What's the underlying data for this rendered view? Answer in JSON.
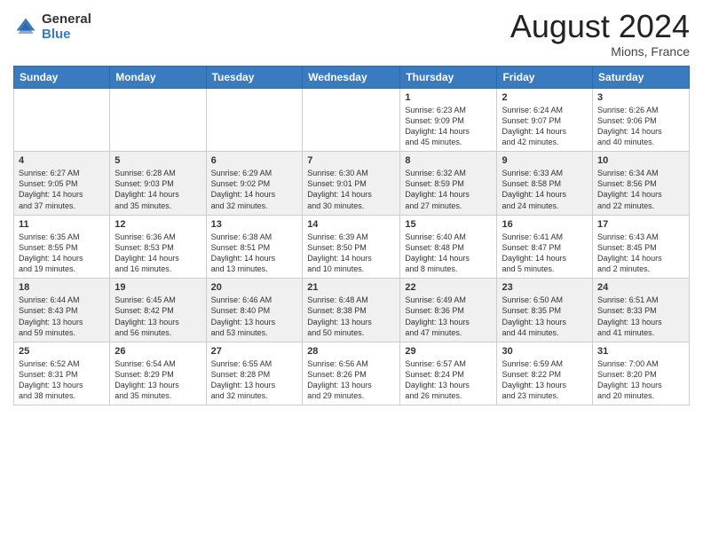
{
  "header": {
    "logo_general": "General",
    "logo_blue": "Blue",
    "month_year": "August 2024",
    "location": "Mions, France"
  },
  "calendar": {
    "days_of_week": [
      "Sunday",
      "Monday",
      "Tuesday",
      "Wednesday",
      "Thursday",
      "Friday",
      "Saturday"
    ],
    "weeks": [
      [
        {
          "day": "",
          "info": ""
        },
        {
          "day": "",
          "info": ""
        },
        {
          "day": "",
          "info": ""
        },
        {
          "day": "",
          "info": ""
        },
        {
          "day": "1",
          "info": "Sunrise: 6:23 AM\nSunset: 9:09 PM\nDaylight: 14 hours\nand 45 minutes."
        },
        {
          "day": "2",
          "info": "Sunrise: 6:24 AM\nSunset: 9:07 PM\nDaylight: 14 hours\nand 42 minutes."
        },
        {
          "day": "3",
          "info": "Sunrise: 6:26 AM\nSunset: 9:06 PM\nDaylight: 14 hours\nand 40 minutes."
        }
      ],
      [
        {
          "day": "4",
          "info": "Sunrise: 6:27 AM\nSunset: 9:05 PM\nDaylight: 14 hours\nand 37 minutes."
        },
        {
          "day": "5",
          "info": "Sunrise: 6:28 AM\nSunset: 9:03 PM\nDaylight: 14 hours\nand 35 minutes."
        },
        {
          "day": "6",
          "info": "Sunrise: 6:29 AM\nSunset: 9:02 PM\nDaylight: 14 hours\nand 32 minutes."
        },
        {
          "day": "7",
          "info": "Sunrise: 6:30 AM\nSunset: 9:01 PM\nDaylight: 14 hours\nand 30 minutes."
        },
        {
          "day": "8",
          "info": "Sunrise: 6:32 AM\nSunset: 8:59 PM\nDaylight: 14 hours\nand 27 minutes."
        },
        {
          "day": "9",
          "info": "Sunrise: 6:33 AM\nSunset: 8:58 PM\nDaylight: 14 hours\nand 24 minutes."
        },
        {
          "day": "10",
          "info": "Sunrise: 6:34 AM\nSunset: 8:56 PM\nDaylight: 14 hours\nand 22 minutes."
        }
      ],
      [
        {
          "day": "11",
          "info": "Sunrise: 6:35 AM\nSunset: 8:55 PM\nDaylight: 14 hours\nand 19 minutes."
        },
        {
          "day": "12",
          "info": "Sunrise: 6:36 AM\nSunset: 8:53 PM\nDaylight: 14 hours\nand 16 minutes."
        },
        {
          "day": "13",
          "info": "Sunrise: 6:38 AM\nSunset: 8:51 PM\nDaylight: 14 hours\nand 13 minutes."
        },
        {
          "day": "14",
          "info": "Sunrise: 6:39 AM\nSunset: 8:50 PM\nDaylight: 14 hours\nand 10 minutes."
        },
        {
          "day": "15",
          "info": "Sunrise: 6:40 AM\nSunset: 8:48 PM\nDaylight: 14 hours\nand 8 minutes."
        },
        {
          "day": "16",
          "info": "Sunrise: 6:41 AM\nSunset: 8:47 PM\nDaylight: 14 hours\nand 5 minutes."
        },
        {
          "day": "17",
          "info": "Sunrise: 6:43 AM\nSunset: 8:45 PM\nDaylight: 14 hours\nand 2 minutes."
        }
      ],
      [
        {
          "day": "18",
          "info": "Sunrise: 6:44 AM\nSunset: 8:43 PM\nDaylight: 13 hours\nand 59 minutes."
        },
        {
          "day": "19",
          "info": "Sunrise: 6:45 AM\nSunset: 8:42 PM\nDaylight: 13 hours\nand 56 minutes."
        },
        {
          "day": "20",
          "info": "Sunrise: 6:46 AM\nSunset: 8:40 PM\nDaylight: 13 hours\nand 53 minutes."
        },
        {
          "day": "21",
          "info": "Sunrise: 6:48 AM\nSunset: 8:38 PM\nDaylight: 13 hours\nand 50 minutes."
        },
        {
          "day": "22",
          "info": "Sunrise: 6:49 AM\nSunset: 8:36 PM\nDaylight: 13 hours\nand 47 minutes."
        },
        {
          "day": "23",
          "info": "Sunrise: 6:50 AM\nSunset: 8:35 PM\nDaylight: 13 hours\nand 44 minutes."
        },
        {
          "day": "24",
          "info": "Sunrise: 6:51 AM\nSunset: 8:33 PM\nDaylight: 13 hours\nand 41 minutes."
        }
      ],
      [
        {
          "day": "25",
          "info": "Sunrise: 6:52 AM\nSunset: 8:31 PM\nDaylight: 13 hours\nand 38 minutes."
        },
        {
          "day": "26",
          "info": "Sunrise: 6:54 AM\nSunset: 8:29 PM\nDaylight: 13 hours\nand 35 minutes."
        },
        {
          "day": "27",
          "info": "Sunrise: 6:55 AM\nSunset: 8:28 PM\nDaylight: 13 hours\nand 32 minutes."
        },
        {
          "day": "28",
          "info": "Sunrise: 6:56 AM\nSunset: 8:26 PM\nDaylight: 13 hours\nand 29 minutes."
        },
        {
          "day": "29",
          "info": "Sunrise: 6:57 AM\nSunset: 8:24 PM\nDaylight: 13 hours\nand 26 minutes."
        },
        {
          "day": "30",
          "info": "Sunrise: 6:59 AM\nSunset: 8:22 PM\nDaylight: 13 hours\nand 23 minutes."
        },
        {
          "day": "31",
          "info": "Sunrise: 7:00 AM\nSunset: 8:20 PM\nDaylight: 13 hours\nand 20 minutes."
        }
      ]
    ]
  }
}
